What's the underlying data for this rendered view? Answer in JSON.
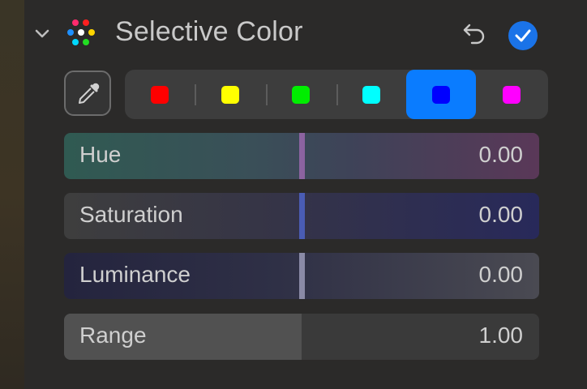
{
  "header": {
    "title": "Selective Color",
    "expand_icon": "chevron-down-icon",
    "adjustment_icon": "color-dots-icon",
    "undo_icon": "undo-arrow-icon",
    "enabled_icon": "checkmark-icon",
    "enabled": true,
    "accent_color": "#1a73e8"
  },
  "color_picker": {
    "eyedropper_icon": "eyedropper-icon",
    "selected_index": 4,
    "swatches": [
      {
        "name": "red",
        "color": "#ff0000"
      },
      {
        "name": "yellow",
        "color": "#ffff00"
      },
      {
        "name": "green",
        "color": "#00ee00"
      },
      {
        "name": "cyan",
        "color": "#00ffff"
      },
      {
        "name": "blue",
        "color": "#0000ff"
      },
      {
        "name": "magenta",
        "color": "#ff00ff"
      }
    ],
    "selected_color": "#0a7cff"
  },
  "sliders": {
    "hue": {
      "label": "Hue",
      "value": "0.00",
      "level": 0.5
    },
    "saturation": {
      "label": "Saturation",
      "value": "0.00",
      "level": 0.5
    },
    "luminance": {
      "label": "Luminance",
      "value": "0.00",
      "level": 0.5
    },
    "range": {
      "label": "Range",
      "value": "1.00",
      "level": 0.5
    }
  }
}
